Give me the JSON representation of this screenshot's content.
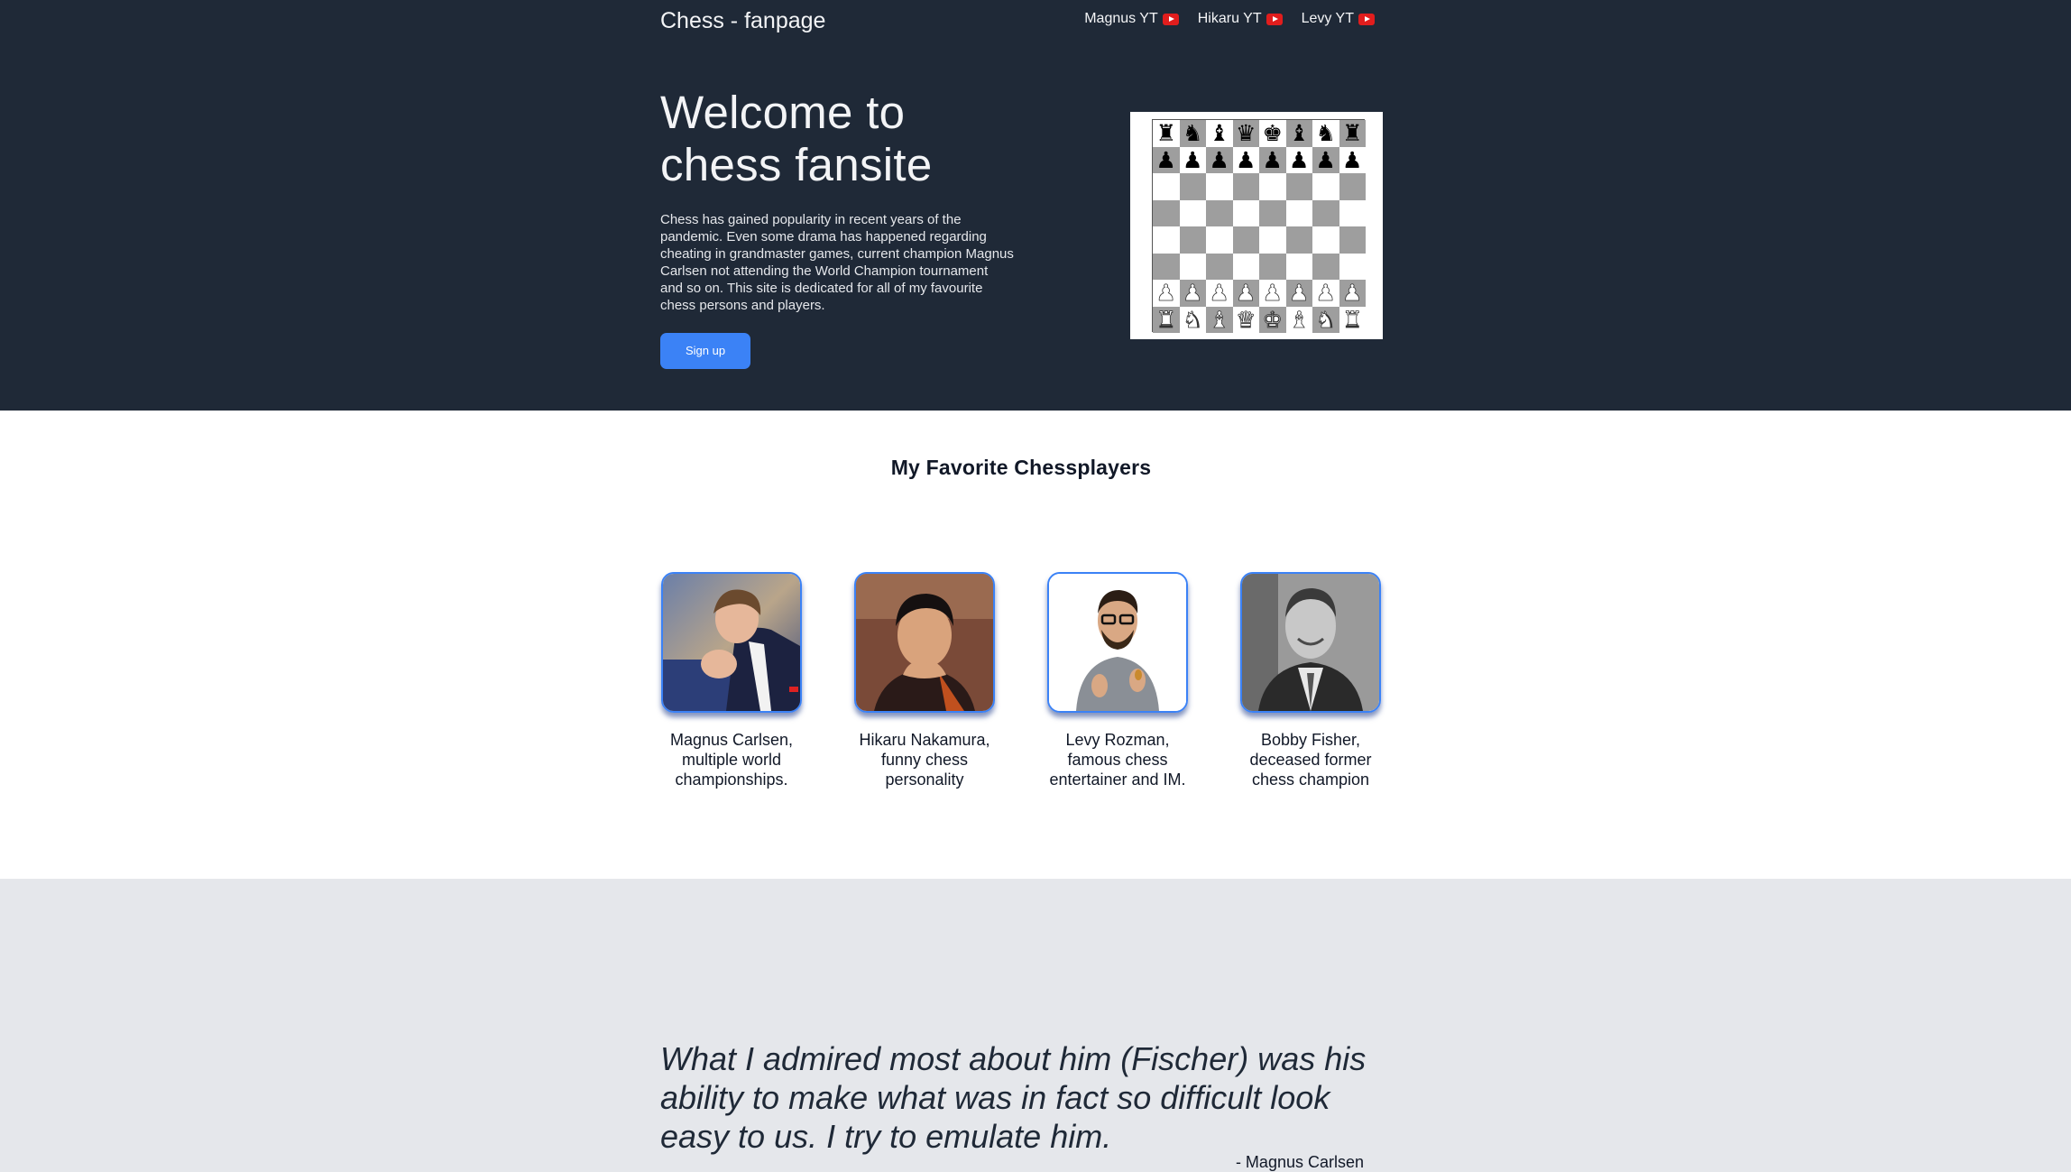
{
  "header": {
    "brand": "Chess - fanpage",
    "links": [
      {
        "label": "Magnus YT",
        "icon": "youtube-icon"
      },
      {
        "label": "Hikaru YT",
        "icon": "youtube-icon"
      },
      {
        "label": "Levy YT",
        "icon": "youtube-icon"
      }
    ]
  },
  "hero": {
    "title_line1": "Welcome to",
    "title_line2": "chess fansite",
    "description": "Chess has gained popularity in recent years of the pandemic. Even some drama has happened regarding cheating in grandmaster games, current champion Magnus Carlsen not attending the World Champion tournament and so on. This site is dedicated for all of my favourite chess persons and players.",
    "signup_label": "Sign up"
  },
  "board": {
    "ranks": [
      [
        "♜",
        "♞",
        "♝",
        "♛",
        "♚",
        "♝",
        "♞",
        "♜"
      ],
      [
        "♟",
        "♟",
        "♟",
        "♟",
        "♟",
        "♟",
        "♟",
        "♟"
      ],
      [
        "",
        "",
        "",
        "",
        "",
        "",
        "",
        ""
      ],
      [
        "",
        "",
        "",
        "",
        "",
        "",
        "",
        ""
      ],
      [
        "",
        "",
        "",
        "",
        "",
        "",
        "",
        ""
      ],
      [
        "",
        "",
        "",
        "",
        "",
        "",
        "",
        ""
      ],
      [
        "♟",
        "♟",
        "♟",
        "♟",
        "♟",
        "♟",
        "♟",
        "♟"
      ],
      [
        "♜",
        "♞",
        "♝",
        "♛",
        "♚",
        "♝",
        "♞",
        "♜"
      ]
    ],
    "black_ranks": [
      0,
      1
    ],
    "white_ranks": [
      6,
      7
    ]
  },
  "players": {
    "title": "My Favorite Chessplayers",
    "items": [
      {
        "caption": "Magnus Carlsen, multiple world championships.",
        "photo": "magnus-carlsen-photo"
      },
      {
        "caption": "Hikaru Nakamura, funny chess personality",
        "photo": "hikaru-nakamura-photo"
      },
      {
        "caption": "Levy Rozman, famous chess entertainer and IM.",
        "photo": "levy-rozman-photo"
      },
      {
        "caption": "Bobby Fisher, deceased former chess champion",
        "photo": "bobby-fischer-photo"
      }
    ]
  },
  "quote": {
    "text": "What I admired most about him (Fischer) was his ability to make what was in fact so difficult look easy to us. I try to emulate him.",
    "author": "- Magnus Carlsen"
  },
  "colors": {
    "hero_bg": "#1f2937",
    "accent": "#3b82f6",
    "quote_bg": "#e5e7eb",
    "youtube_red": "#e11d1d"
  }
}
